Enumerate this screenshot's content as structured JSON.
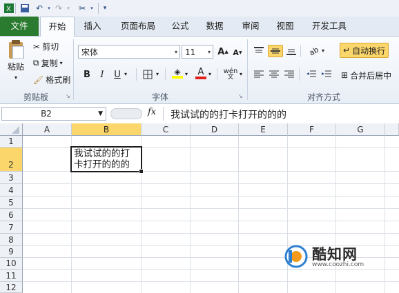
{
  "tabs": [
    "文件",
    "开始",
    "插入",
    "页面布局",
    "公式",
    "数据",
    "审阅",
    "视图",
    "开发工具"
  ],
  "clipboard": {
    "paste": "粘贴",
    "cut": "剪切",
    "copy": "复制",
    "format_painter": "格式刷",
    "group": "剪贴板"
  },
  "font": {
    "name": "宋体",
    "size": "11",
    "group": "字体",
    "grow": "A",
    "shrink": "A",
    "bold": "B",
    "italic": "I",
    "underline": "U",
    "color_a": "A",
    "wen": "wén"
  },
  "alignment": {
    "wrap_text": "自动换行",
    "merge_center": "合并后居中",
    "group": "对齐方式"
  },
  "formula_bar": {
    "name_box": "B2",
    "fx": "fx",
    "content": "我试试的的打卡打开的的的"
  },
  "columns": [
    "A",
    "B",
    "C",
    "D",
    "E",
    "F",
    "G"
  ],
  "rows": [
    "1",
    "2",
    "3",
    "4",
    "5",
    "6",
    "7",
    "8",
    "9",
    "10",
    "11",
    "12"
  ],
  "cell_b2": {
    "line1": "我试试的的打",
    "line2": "卡打开的的的"
  },
  "watermark": {
    "name": "酷知网",
    "url": "www.coozhi.com"
  },
  "colors": {
    "file_tab": "#2a7a2f",
    "selected_header": "#fbd66b",
    "accent": "#2d4e86"
  }
}
